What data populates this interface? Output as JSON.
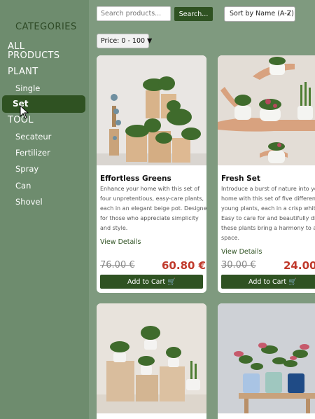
{
  "sidebar": {
    "title": "CATEGORIES",
    "all_products": "ALL\nPRODUCTS",
    "all_line1": "ALL",
    "all_line2": "PRODUCTS",
    "plant": "PLANT",
    "plant_items": [
      "Single",
      "Set"
    ],
    "tool": "TOOL",
    "tool_items": [
      "Secateur",
      "Fertilizer",
      "Spray",
      "Can",
      "Shovel"
    ]
  },
  "search": {
    "placeholder": "Search products...",
    "value": "",
    "button": "Search..."
  },
  "sort": {
    "selected": "Sort by Name (A-Z)"
  },
  "filter": {
    "price": "Price: 0 - 100 ▼"
  },
  "products": [
    {
      "title": "Effortless Greens",
      "desc": [
        "Enhance your home with this set of",
        "four unpretentious, easy-care plants,",
        "each in an elegant beige pot. Designed",
        "for those who appreciate simplicity",
        "and style."
      ],
      "link": "View Details",
      "old_price": "76.00 €",
      "new_price": "60.80 €",
      "button": "Add to Cart 🛒"
    },
    {
      "title": "Fresh Set",
      "desc": [
        "Introduce a burst of nature into your",
        "home with this set of five different",
        "young plants, each in a crisp white p",
        "Easy to care for and beautifully dive",
        "these plants bring a harmony to any",
        "space."
      ],
      "link": "View Details",
      "old_price": "30.00 €",
      "new_price": "24.00",
      "button": "Add to Cart 🛒"
    }
  ],
  "colors": {
    "brand_green": "#2f5222",
    "sale_red": "#c0392b",
    "sidebar_bg": "#6e8c6e",
    "page_bg": "#7f9a7f"
  }
}
